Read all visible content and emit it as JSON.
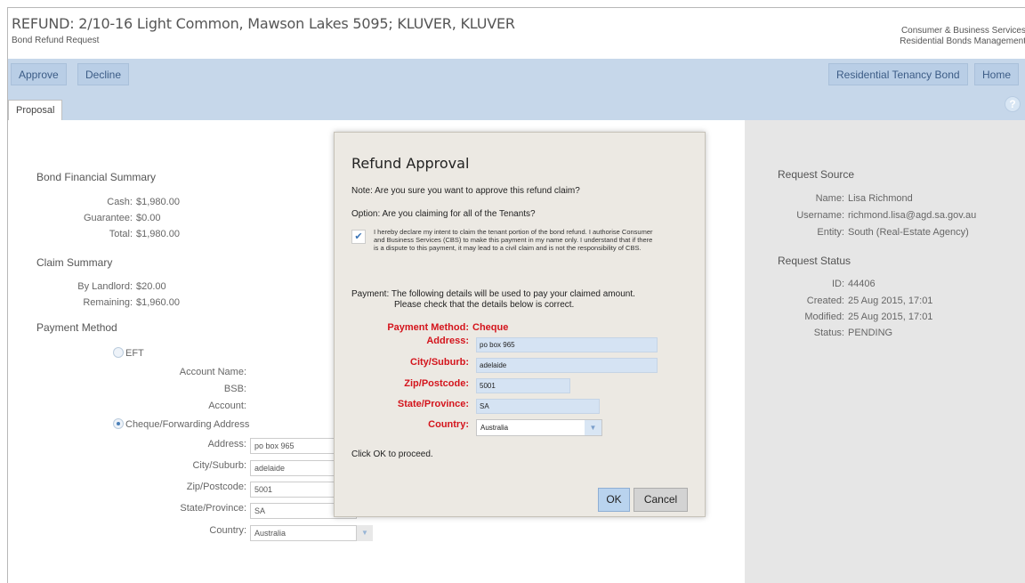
{
  "header": {
    "title": "REFUND: 2/10-16 Light Common, Mawson Lakes 5095; KLUVER, KLUVER",
    "subtitle": "Bond Refund Request",
    "org_line1": "Consumer & Business Services",
    "org_line2": "Residential Bonds Management"
  },
  "toolbar": {
    "approve": "Approve",
    "decline": "Decline",
    "residential_tenancy_bond": "Residential Tenancy Bond",
    "home": "Home"
  },
  "tabs": [
    {
      "label": "Proposal"
    }
  ],
  "help_icon": "?",
  "bond_summary": {
    "heading": "Bond Financial Summary",
    "cash_label": "Cash:",
    "cash_value": "$1,980.00",
    "guarantee_label": "Guarantee:",
    "guarantee_value": "$0.00",
    "total_label": "Total:",
    "total_value": "$1,980.00"
  },
  "claim_summary": {
    "heading": "Claim Summary",
    "landlord_label": "By Landlord:",
    "landlord_value": "$20.00",
    "remaining_label": "Remaining:",
    "remaining_value": "$1,960.00"
  },
  "payment_method": {
    "heading": "Payment Method",
    "eft_label": "EFT",
    "account_name_label": "Account Name:",
    "bsb_label": "BSB:",
    "account_label": "Account:",
    "cheque_label": "Cheque/Forwarding Address",
    "address_label": "Address:",
    "address_value": "po box 965",
    "city_label": "City/Suburb:",
    "city_value": "adelaide",
    "zip_label": "Zip/Postcode:",
    "zip_value": "5001",
    "state_label": "State/Province:",
    "state_value": "SA",
    "country_label": "Country:",
    "country_value": "Australia"
  },
  "request_source": {
    "heading": "Request Source",
    "name_label": "Name:",
    "name_value": "Lisa Richmond",
    "username_label": "Username:",
    "username_value": "richmond.lisa@agd.sa.gov.au",
    "entity_label": "Entity:",
    "entity_value": "South (Real-Estate Agency)"
  },
  "request_status": {
    "heading": "Request Status",
    "id_label": "ID:",
    "id_value": "44406",
    "created_label": "Created:",
    "created_value": "25 Aug 2015, 17:01",
    "modified_label": "Modified:",
    "modified_value": "25 Aug 2015, 17:01",
    "status_label": "Status:",
    "status_value": "PENDING"
  },
  "modal": {
    "title": "Refund Approval",
    "note": "Note: Are you sure you want to approve this refund claim?",
    "option": "Option: Are you claiming for all of the Tenants?",
    "declaration": "I hereby declare my intent to claim the tenant portion of the bond refund. I authorise Consumer and Business Services (CBS) to make this payment in my name only. I understand that if there is a dispute to this payment, it may lead to a civil claim and is not the responsibility of CBS.",
    "payment_line1": "Payment: The following details will be used to pay your claimed amount.",
    "payment_line2": "Please check that the details below is correct.",
    "method_label": "Payment Method:",
    "method_value": "Cheque",
    "address_label": "Address:",
    "address_value": "po box 965",
    "city_label": "City/Suburb:",
    "city_value": "adelaide",
    "zip_label": "Zip/Postcode:",
    "zip_value": "5001",
    "state_label": "State/Province:",
    "state_value": "SA",
    "country_label": "Country:",
    "country_value": "Australia",
    "proceed": "Click OK to proceed.",
    "ok": "OK",
    "cancel": "Cancel"
  }
}
